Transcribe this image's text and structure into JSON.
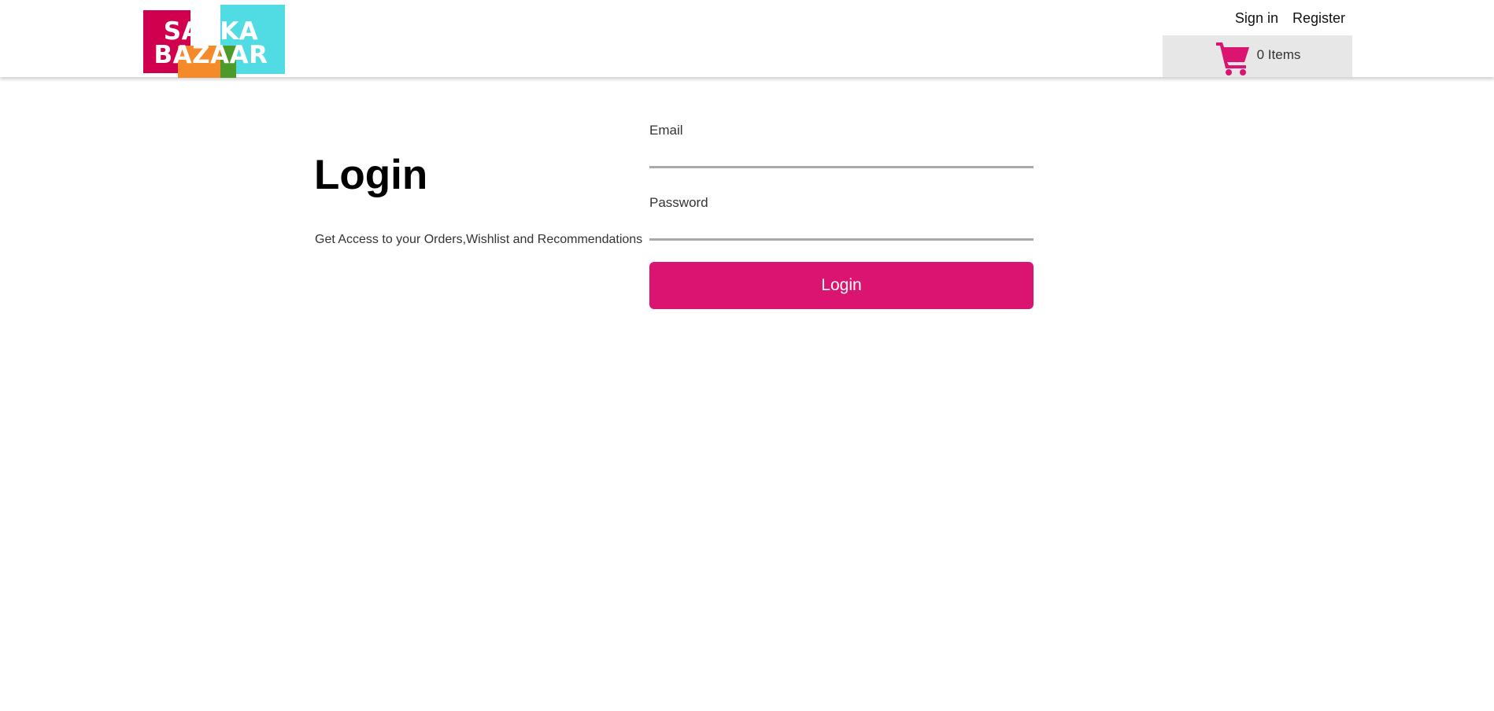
{
  "brand": {
    "logo_line1": "SABKA",
    "logo_line2": "BAZAAR",
    "colors": {
      "crimson": "#d1004f",
      "orange": "#f58a2a",
      "green": "#4c9a2a",
      "cyan": "#51dbe3"
    }
  },
  "header": {
    "signin_label": "Sign in",
    "register_label": "Register",
    "cart": {
      "icon": "shopping-cart-icon",
      "count_text": "0 Items",
      "icon_color": "#dc1471",
      "background": "#e8e7e7"
    }
  },
  "main": {
    "title": "Login",
    "subtitle": "Get Access to your Orders,Wishlist and Recommendations",
    "form": {
      "email_label": "Email",
      "email_value": "",
      "password_label": "Password",
      "password_value": "",
      "submit_label": "Login",
      "accent": "#dc1471"
    }
  }
}
